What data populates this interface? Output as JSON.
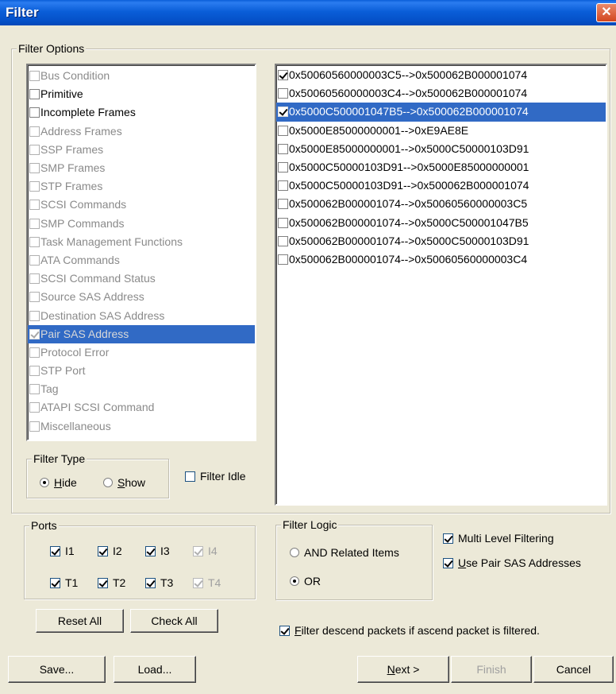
{
  "window": {
    "title": "Filter",
    "close_glyph": "✕"
  },
  "filter_options": {
    "legend": "Filter Options",
    "items": [
      {
        "label": "Bus Condition",
        "checked": false,
        "enabled": false,
        "selected": false
      },
      {
        "label": "Primitive",
        "checked": false,
        "enabled": true,
        "selected": false
      },
      {
        "label": "Incomplete Frames",
        "checked": false,
        "enabled": true,
        "selected": false
      },
      {
        "label": "Address Frames",
        "checked": false,
        "enabled": false,
        "selected": false
      },
      {
        "label": "SSP Frames",
        "checked": false,
        "enabled": false,
        "selected": false
      },
      {
        "label": "SMP Frames",
        "checked": false,
        "enabled": false,
        "selected": false
      },
      {
        "label": "STP Frames",
        "checked": false,
        "enabled": false,
        "selected": false
      },
      {
        "label": "SCSI Commands",
        "checked": false,
        "enabled": false,
        "selected": false
      },
      {
        "label": "SMP Commands",
        "checked": false,
        "enabled": false,
        "selected": false
      },
      {
        "label": "Task Management Functions",
        "checked": false,
        "enabled": false,
        "selected": false
      },
      {
        "label": "ATA Commands",
        "checked": false,
        "enabled": false,
        "selected": false
      },
      {
        "label": "SCSI Command Status",
        "checked": false,
        "enabled": false,
        "selected": false
      },
      {
        "label": "Source SAS Address",
        "checked": false,
        "enabled": false,
        "selected": false
      },
      {
        "label": "Destination SAS Address",
        "checked": false,
        "enabled": false,
        "selected": false
      },
      {
        "label": "Pair SAS Address",
        "checked": true,
        "enabled": false,
        "selected": true
      },
      {
        "label": "Protocol Error",
        "checked": false,
        "enabled": false,
        "selected": false
      },
      {
        "label": "STP Port",
        "checked": false,
        "enabled": false,
        "selected": false
      },
      {
        "label": "Tag",
        "checked": false,
        "enabled": false,
        "selected": false
      },
      {
        "label": "ATAPI SCSI Command",
        "checked": false,
        "enabled": false,
        "selected": false
      },
      {
        "label": "Miscellaneous",
        "checked": false,
        "enabled": false,
        "selected": false
      }
    ]
  },
  "address_pairs": [
    {
      "label": "0x50060560000003C5-->0x500062B000001074",
      "checked": true,
      "selected": false
    },
    {
      "label": "0x50060560000003C4-->0x500062B000001074",
      "checked": false,
      "selected": false
    },
    {
      "label": "0x5000C500001047B5-->0x500062B000001074",
      "checked": true,
      "selected": true
    },
    {
      "label": "0x5000E85000000001-->0xE9AE8E",
      "checked": false,
      "selected": false
    },
    {
      "label": "0x5000E85000000001-->0x5000C50000103D91",
      "checked": false,
      "selected": false
    },
    {
      "label": "0x5000C50000103D91-->0x5000E85000000001",
      "checked": false,
      "selected": false
    },
    {
      "label": "0x5000C50000103D91-->0x500062B000001074",
      "checked": false,
      "selected": false
    },
    {
      "label": "0x500062B000001074-->0x50060560000003C5",
      "checked": false,
      "selected": false
    },
    {
      "label": "0x500062B000001074-->0x5000C500001047B5",
      "checked": false,
      "selected": false
    },
    {
      "label": "0x500062B000001074-->0x5000C50000103D91",
      "checked": false,
      "selected": false
    },
    {
      "label": "0x500062B000001074-->0x50060560000003C4",
      "checked": false,
      "selected": false
    }
  ],
  "filter_type": {
    "legend": "Filter Type",
    "hide": {
      "label_u": "H",
      "label_rest": "ide",
      "selected": true
    },
    "show": {
      "label_u": "S",
      "label_rest": "how",
      "selected": false
    }
  },
  "filter_idle": {
    "label": "Filter Idle",
    "checked": false
  },
  "ports": {
    "legend": "Ports",
    "items": [
      {
        "id": "i1",
        "label": "I1",
        "checked": true,
        "enabled": true
      },
      {
        "id": "i2",
        "label": "I2",
        "checked": true,
        "enabled": true
      },
      {
        "id": "i3",
        "label": "I3",
        "checked": true,
        "enabled": true
      },
      {
        "id": "i4",
        "label": "I4",
        "checked": true,
        "enabled": false
      },
      {
        "id": "t1",
        "label": "T1",
        "checked": true,
        "enabled": true
      },
      {
        "id": "t2",
        "label": "T2",
        "checked": true,
        "enabled": true
      },
      {
        "id": "t3",
        "label": "T3",
        "checked": true,
        "enabled": true
      },
      {
        "id": "t4",
        "label": "T4",
        "checked": true,
        "enabled": false
      }
    ]
  },
  "filter_logic": {
    "legend": "Filter Logic",
    "and_related": {
      "label": "AND Related Items",
      "selected": false
    },
    "or": {
      "label": "OR",
      "selected": true
    }
  },
  "multi_level": {
    "label": "Multi Level Filtering",
    "checked": true
  },
  "use_pair": {
    "label_u": "U",
    "label_rest": "se Pair SAS Addresses",
    "checked": true
  },
  "filter_descend": {
    "label_u": "F",
    "label_rest": "ilter descend packets if ascend packet is filtered.",
    "checked": true
  },
  "buttons": {
    "reset_all": "Reset All",
    "check_all": "Check All",
    "save": "Save...",
    "load": "Load...",
    "next_u": "N",
    "next_rest": "ext >",
    "finish": "Finish",
    "cancel": "Cancel"
  }
}
